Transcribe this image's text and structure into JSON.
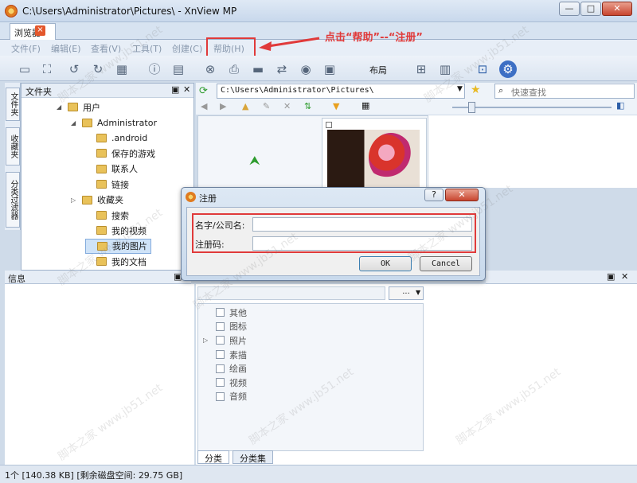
{
  "window": {
    "title": "C:\\Users\\Administrator\\Pictures\\ - XnView MP",
    "minimize": "—",
    "maximize": "□",
    "close": "✕"
  },
  "tab": {
    "label": "浏览器",
    "close": "×"
  },
  "menu": {
    "items": [
      "文件(F)",
      "编辑(E)",
      "查看(V)",
      "工具(T)",
      "创建(C)",
      "帮助(H)"
    ]
  },
  "annotation": {
    "text": "点击“帮助”--“注册”"
  },
  "toolbar": {
    "layout_label": "布局",
    "icons": [
      "screen-icon",
      "fullscreen-icon",
      "rotate-left-icon",
      "rotate-right-icon",
      "image-settings-icon",
      "info-icon",
      "open-icon",
      "binoculars-icon",
      "print-icon",
      "scanner-icon",
      "convert-icon",
      "capture-icon",
      "slideshow-icon",
      "compare-icon",
      "file-list-icon",
      "tree-icon",
      "settings-icon",
      "help-icon"
    ]
  },
  "side_tabs": [
    "文件夹",
    "收藏夹",
    "分类过滤器"
  ],
  "folder_panel": {
    "title": "文件夹",
    "tree": [
      "用户",
      "Administrator",
      ".android",
      "保存的游戏",
      "联系人",
      "链接",
      "收藏夹",
      "搜索",
      "我的视频",
      "我的图片",
      "我的文档"
    ]
  },
  "path": {
    "value": "C:\\Users\\Administrator\\Pictures\\",
    "search_placeholder": "快速查找"
  },
  "dialog": {
    "title": "注册",
    "help": "?",
    "close": "✕",
    "name_label": "名字/公司名:",
    "code_label": "注册码:",
    "ok": "OK",
    "cancel": "Cancel"
  },
  "info_panel": {
    "title": "信息"
  },
  "categories": {
    "dots": "...",
    "items": [
      "其他",
      "图标",
      "照片",
      "素描",
      "绘画",
      "视频",
      "音频"
    ],
    "tabs": [
      "分类",
      "分类集"
    ]
  },
  "status": {
    "text": "1个 [140.38 KB] [剩余磁盘空间: 29.75 GB]"
  },
  "watermark": "脚本之家  www.jb51.net",
  "colors": {
    "accent_red": "#e03a3a",
    "selection": "#cfe3f8"
  }
}
